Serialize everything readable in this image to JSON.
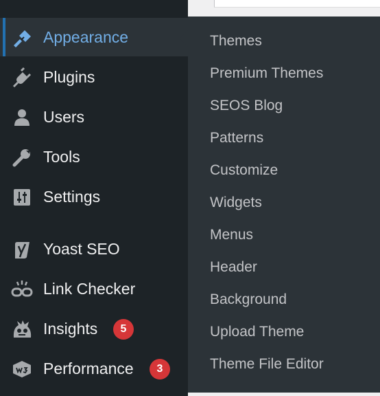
{
  "sidebar": {
    "items": [
      {
        "label": "Appearance",
        "icon": "paintbrush-icon",
        "active": true
      },
      {
        "label": "Plugins",
        "icon": "plugin-icon"
      },
      {
        "label": "Users",
        "icon": "user-icon"
      },
      {
        "label": "Tools",
        "icon": "wrench-icon"
      },
      {
        "label": "Settings",
        "icon": "settings-sliders-icon"
      },
      {
        "label": "Yoast SEO",
        "icon": "yoast-icon"
      },
      {
        "label": "Link Checker",
        "icon": "broken-link-icon"
      },
      {
        "label": "Insights",
        "icon": "monster-insights-icon",
        "badge": "5"
      },
      {
        "label": "Performance",
        "icon": "w3-performance-icon",
        "badge": "3"
      }
    ]
  },
  "submenu": {
    "items": [
      "Themes",
      "Premium Themes",
      "SEOS Blog",
      "Patterns",
      "Customize",
      "Widgets",
      "Menus",
      "Header",
      "Background",
      "Upload Theme",
      "Theme File Editor"
    ]
  },
  "colors": {
    "sidebar_bg": "#1d2327",
    "flyout_bg": "#2c3338",
    "active_text": "#72aee6",
    "active_bar": "#2271b1",
    "badge": "#d63638",
    "submenu_text": "#c3c4c7",
    "menu_text": "#f0f0f1"
  }
}
